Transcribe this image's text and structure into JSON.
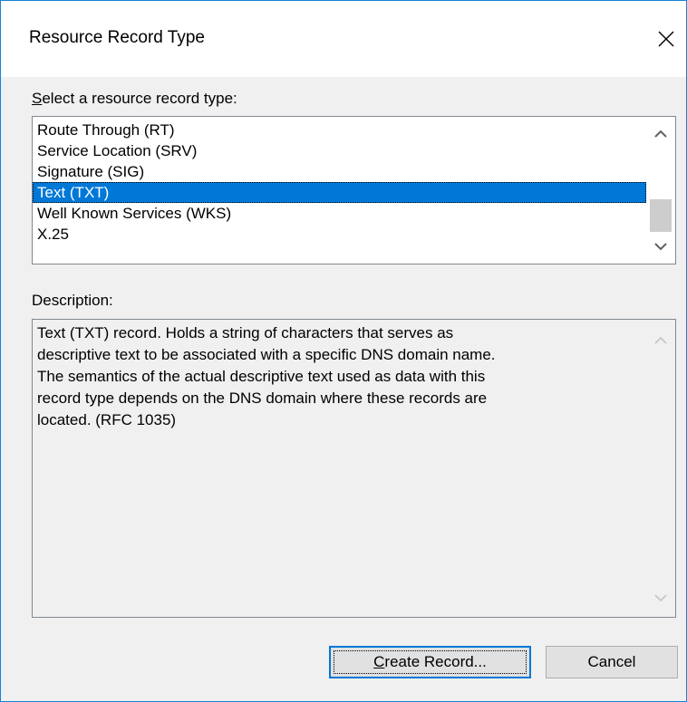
{
  "window": {
    "title": "Resource Record Type"
  },
  "select_label": {
    "mnemonic": "S",
    "rest": "elect a resource record type:"
  },
  "record_types": [
    {
      "label": "Route Through (RT)",
      "selected": false
    },
    {
      "label": "Service Location (SRV)",
      "selected": false
    },
    {
      "label": "Signature (SIG)",
      "selected": false
    },
    {
      "label": "Text (TXT)",
      "selected": true
    },
    {
      "label": "Well Known Services (WKS)",
      "selected": false
    },
    {
      "label": "X.25",
      "selected": false
    }
  ],
  "description": {
    "label": "Description:",
    "lines": [
      "Text (TXT) record. Holds a string of characters that serves as",
      "descriptive text to be associated with a specific DNS domain name.",
      "The semantics of the actual descriptive text used as data with this",
      "record type depends on the DNS domain where these records are",
      "located. (RFC 1035)"
    ]
  },
  "buttons": {
    "create": {
      "mnemonic": "C",
      "rest": "reate Record..."
    },
    "cancel": "Cancel"
  },
  "colors": {
    "selection": "#0078d7",
    "window_border": "#1883d7"
  }
}
